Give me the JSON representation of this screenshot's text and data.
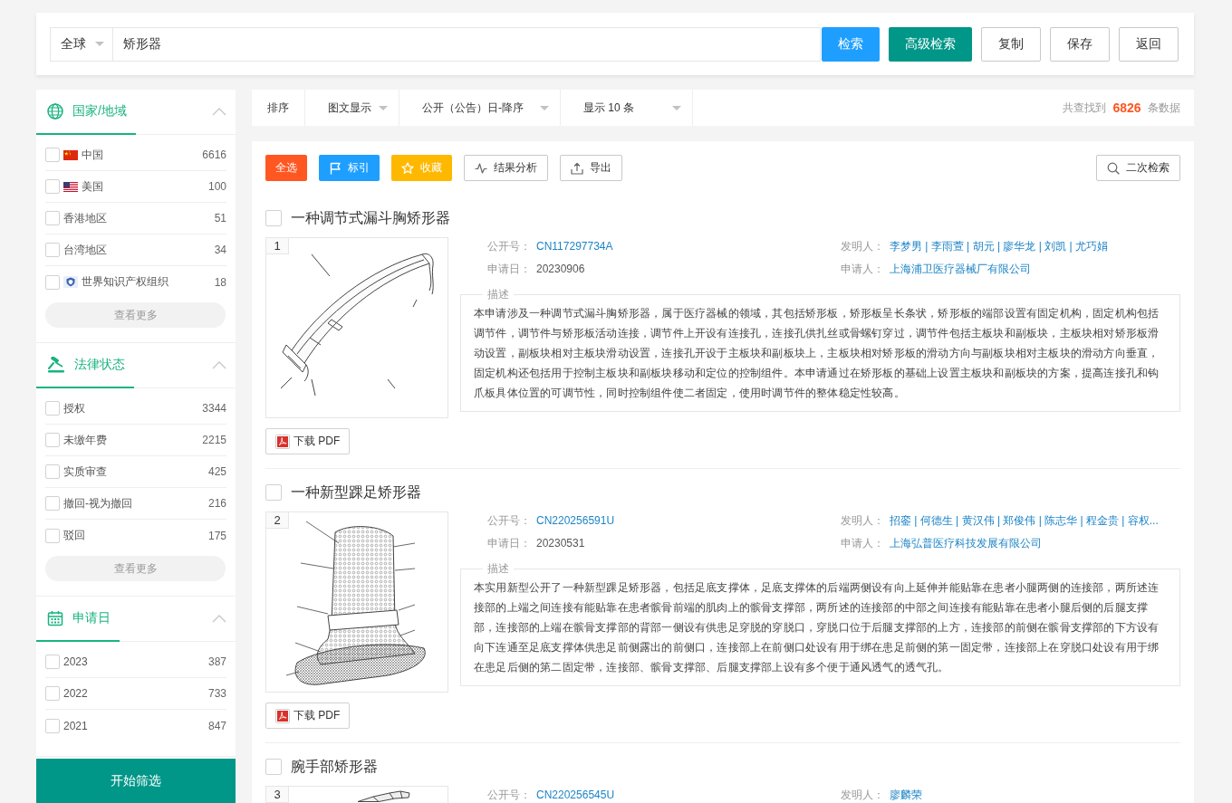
{
  "search": {
    "scope": "全球",
    "value": "矫形器",
    "buttons": [
      {
        "label": "检索",
        "kind": "primary"
      },
      {
        "label": "高级检索",
        "kind": "accent"
      },
      {
        "label": "复制",
        "kind": "plain"
      },
      {
        "label": "保存",
        "kind": "plain"
      },
      {
        "label": "返回",
        "kind": "plain"
      }
    ]
  },
  "filters": [
    {
      "kind": "region",
      "title": "国家/地域",
      "expanded": true,
      "items": [
        {
          "label": "中国",
          "count": "6616",
          "checked": false,
          "kind": "china"
        },
        {
          "label": "美国",
          "count": "100",
          "checked": false,
          "kind": "usa"
        },
        {
          "label": "香港地区",
          "count": "51",
          "checked": false,
          "kind": "region"
        },
        {
          "label": "台湾地区",
          "count": "34",
          "checked": false,
          "kind": "region"
        },
        {
          "label": "世界知识产权组织",
          "count": "18",
          "checked": false,
          "kind": "organization"
        }
      ],
      "more": "查看更多"
    },
    {
      "kind": "status",
      "title": "法律状态",
      "expanded": true,
      "items": [
        {
          "label": "授权",
          "count": "3344",
          "checked": false
        },
        {
          "label": "未缴年费",
          "count": "2215",
          "checked": false
        },
        {
          "label": "实质审查",
          "count": "425",
          "checked": false
        },
        {
          "label": "撤回-视为撤回",
          "count": "216",
          "checked": false
        },
        {
          "label": "驳回",
          "count": "175",
          "checked": false
        }
      ],
      "more": "查看更多"
    },
    {
      "kind": "date",
      "title": "申请日",
      "expanded": true,
      "items": [
        {
          "label": "2023",
          "count": "387",
          "checked": false
        },
        {
          "label": "2022",
          "count": "733",
          "checked": false
        },
        {
          "label": "2021",
          "count": "847",
          "checked": false
        }
      ]
    }
  ],
  "apply_button": "开始筛选",
  "toolbar": {
    "label": "排序",
    "dropdowns": [
      "图文显示",
      "公开（公告）日-降序",
      "显示 10 条"
    ],
    "total": "共查找到 **6826** 条数据"
  },
  "actions": [
    {
      "label": "全选",
      "kind": "select"
    },
    {
      "label": "标引",
      "kind": "mark"
    },
    {
      "label": "收藏",
      "kind": "favorite"
    },
    {
      "label": "结果分析",
      "kind": "analyze"
    },
    {
      "label": "导出",
      "kind": "export"
    },
    {
      "label": "二次检索",
      "kind": "refine"
    }
  ],
  "results": [
    {
      "title": "一种调节式漏斗胸矫形器",
      "checked": false,
      "number": "1",
      "fields": [
        {
          "label": "公开号：",
          "value": "CN117297734A",
          "link": true
        },
        {
          "label": "发明人：",
          "value": "李梦男 | 李雨萱 | 胡元 | 廖华龙 | 刘凯 | 尤巧娟",
          "link": true
        },
        {
          "label": "申请日：",
          "value": "20230906",
          "link": false
        },
        {
          "label": "申请人：",
          "value": "上海浦卫医疗器械厂有限公司",
          "link": true
        }
      ],
      "description_label": "描述",
      "description": "本申请涉及一种调节式漏斗胸矫形器，属于医疗器械的领域，其包括矫形板，矫形板呈长条状，矫形板的端部设置有固定机构，固定机构包括调节件，调节件与矫形板活动连接，调节件上开设有连接孔，连接孔供扎丝或骨螺钉穿过，调节件包括主板块和副板块，主板块相对矫形板滑动设置，副板块相对主板块滑动设置，连接孔开设于主板块和副板块上，主板块相对矫形板的滑动方向与副板块相对主板块的滑动方向垂直，固定机构还包括用于控制主板块和副板块移动和定位的控制组件。本申请通过在矫形板的基础上设置主板块和副板块的方案，提高连接孔和钩爪板具体位置的可调节性，同时控制组件使二者固定，使用时调节件的整体稳定性较高。",
      "download": "下载 PDF"
    },
    {
      "title": "一种新型踝足矫形器",
      "checked": false,
      "number": "2",
      "fields": [
        {
          "label": "公开号：",
          "value": "CN220256591U",
          "link": true
        },
        {
          "label": "发明人：",
          "value": "招銮 | 何德生 | 黄汉伟 | 郑俊伟 | 陈志华 | 程金贵 | 容权...",
          "link": true
        },
        {
          "label": "申请日：",
          "value": "20230531",
          "link": false
        },
        {
          "label": "申请人：",
          "value": "上海弘普医疗科技发展有限公司",
          "link": true
        }
      ],
      "description_label": "描述",
      "description": "本实用新型公开了一种新型踝足矫形器，包括足底支撑体，足底支撑体的后端两侧设有向上延伸并能贴靠在患者小腿两侧的连接部，两所述连接部的上端之间连接有能贴靠在患者髌骨前端的肌肉上的髌骨支撑部，两所述的连接部的中部之间连接有能贴靠在患者小腿后侧的后腿支撑部，连接部的上端在髌骨支撑部的背部一侧设有供患足穿脱的穿脱口，穿脱口位于后腿支撑部的上方，连接部的前侧在髌骨支撑部的下方设有向下连通至足底支撑体供患足前侧露出的前侧口，连接部上在前侧口处设有用于绑在患足前侧的第一固定带，连接部上在穿脱口处设有用于绑在患足后侧的第二固定带，连接部、髌骨支撑部、后腿支撑部上设有多个便于通风透气的透气孔。",
      "download": "下载 PDF"
    },
    {
      "title": "腕手部矫形器",
      "checked": false,
      "number": "3",
      "fields": [
        {
          "label": "公开号：",
          "value": "CN220256545U",
          "link": true
        },
        {
          "label": "发明人：",
          "value": "廖麟荣",
          "link": true
        }
      ]
    }
  ]
}
